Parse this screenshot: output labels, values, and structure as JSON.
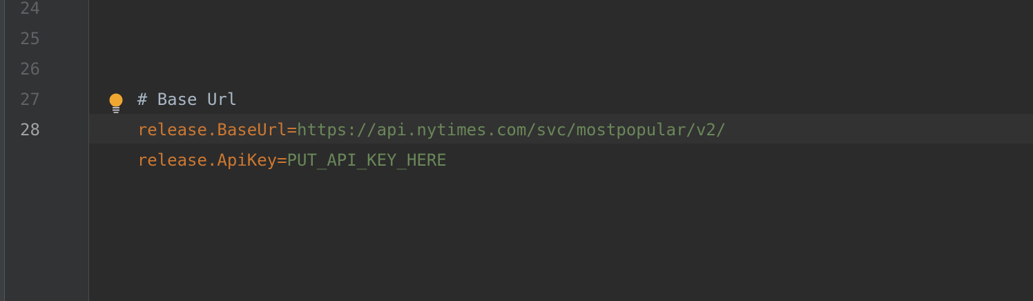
{
  "editor": {
    "lines": [
      {
        "number": "24",
        "text": ""
      },
      {
        "number": "25",
        "text": ""
      },
      {
        "number": "26",
        "comment": "# Base Url"
      },
      {
        "number": "27",
        "key": "release.BaseUrl",
        "eq": "=",
        "value": "https://api.nytimes.com/svc/mostpopular/v2/"
      },
      {
        "number": "28",
        "key": "release.ApiKey",
        "eq": "=",
        "value": "PUT_API_KEY_HERE"
      }
    ],
    "current_line": "28",
    "intention_icon": "lightbulb-icon",
    "colors": {
      "background": "#2b2b2b",
      "gutter": "#313335",
      "key": "#cc7832",
      "value": "#6a8759",
      "comment": "#a9b7c6",
      "line_number": "#606366",
      "bulb": "#f0a732"
    }
  }
}
